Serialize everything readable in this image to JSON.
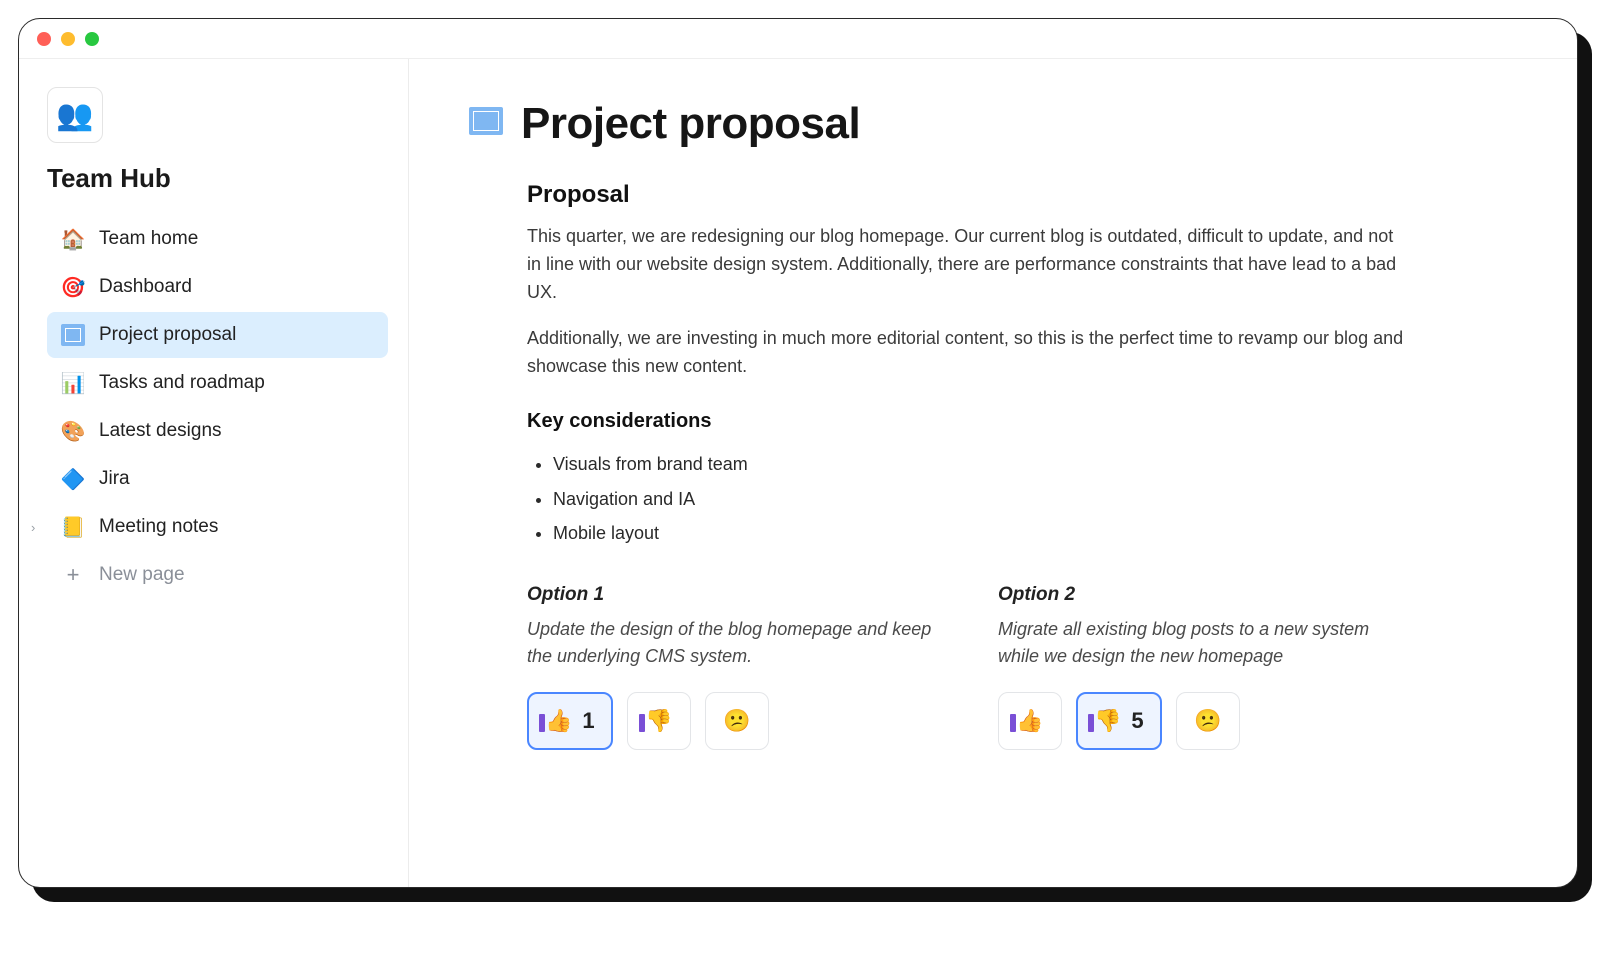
{
  "workspace": {
    "title": "Team Hub",
    "icon": "👥"
  },
  "sidebar": {
    "items": [
      {
        "icon": "🏠",
        "label": "Team home",
        "active": false
      },
      {
        "icon": "🎯",
        "label": "Dashboard",
        "active": false
      },
      {
        "icon": "📐",
        "label": "Project proposal",
        "active": true
      },
      {
        "icon": "📊",
        "label": "Tasks and roadmap",
        "active": false
      },
      {
        "icon": "🎨",
        "label": "Latest designs",
        "active": false
      },
      {
        "icon": "🔷",
        "label": "Jira",
        "active": false
      },
      {
        "icon": "📒",
        "label": "Meeting notes",
        "active": false,
        "expandable": true
      }
    ],
    "new_page_label": "New page"
  },
  "page": {
    "icon": "📐",
    "title": "Project proposal",
    "section_heading": "Proposal",
    "paragraphs": [
      "This quarter, we are redesigning our blog homepage. Our current blog is outdated, difficult to update, and not in line with our website design system. Additionally, there are performance constraints that have lead to a bad UX.",
      "Additionally, we are investing in much more editorial content, so this is the perfect time to revamp our blog and showcase this new content."
    ],
    "subheading": "Key considerations",
    "bullets": [
      "Visuals from brand team",
      "Navigation and IA",
      "Mobile layout"
    ],
    "options": [
      {
        "title": "Option 1",
        "desc": "Update the design of the blog homepage and keep the underlying CMS system.",
        "reactions": [
          {
            "type": "thumbs-up",
            "count": 1,
            "selected": true
          },
          {
            "type": "thumbs-down",
            "count": null,
            "selected": false
          },
          {
            "type": "confused",
            "count": null,
            "selected": false
          }
        ]
      },
      {
        "title": "Option 2",
        "desc": "Migrate all existing blog posts to a new system while we design the new homepage",
        "reactions": [
          {
            "type": "thumbs-up",
            "count": null,
            "selected": false
          },
          {
            "type": "thumbs-down",
            "count": 5,
            "selected": true
          },
          {
            "type": "confused",
            "count": null,
            "selected": false
          }
        ]
      }
    ]
  }
}
